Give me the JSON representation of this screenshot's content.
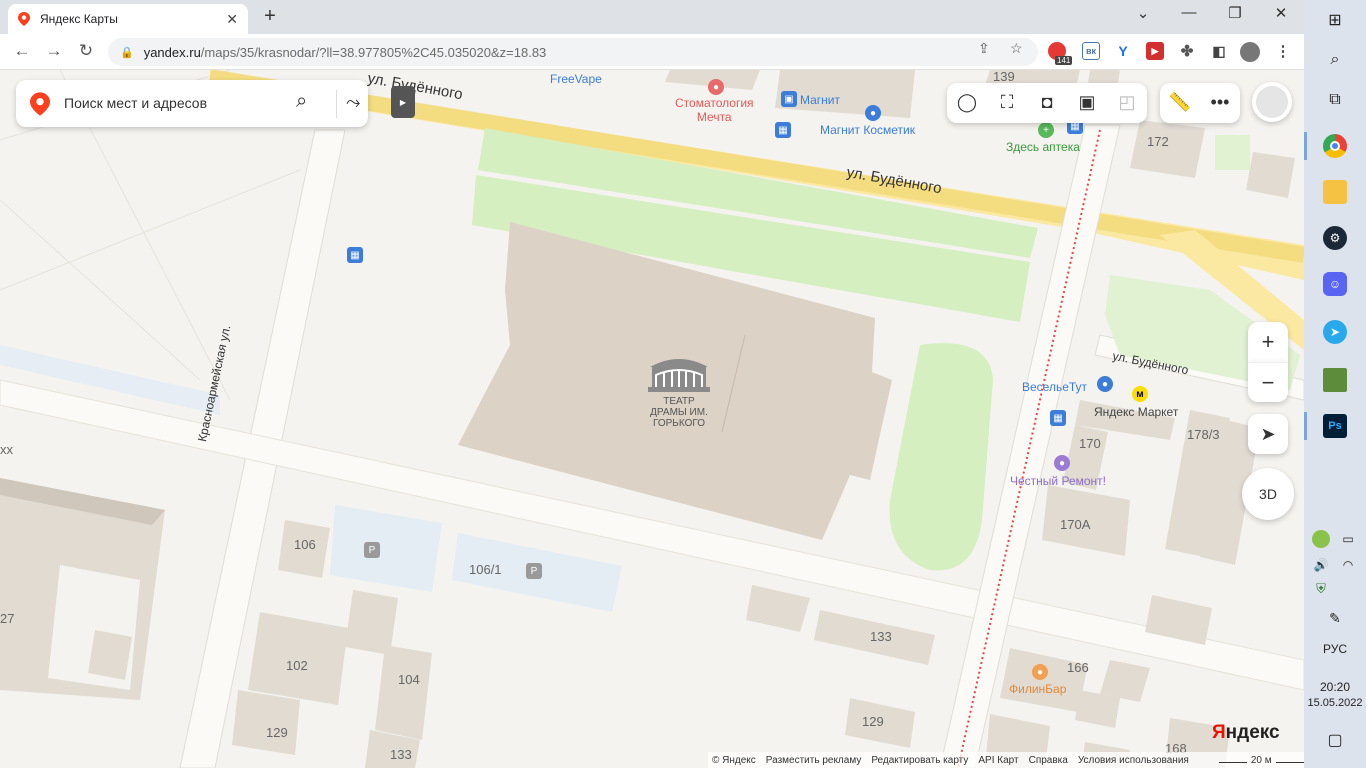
{
  "browser": {
    "tab_title": "Яндекс Карты",
    "url_host": "yandex.ru",
    "url_path": "/maps/35/krasnodar/?ll=38.977805%2C45.035020&z=18.83",
    "ext_badge": "141"
  },
  "search": {
    "placeholder": "Поиск мест и адресов"
  },
  "map": {
    "streets": {
      "budennogo_top": "ул. Будённого",
      "budennogo_mid": "ул. Будённого",
      "budennogo_right": "ул. Будённого",
      "krasnoarmeyskaya": "Красноармейская ул."
    },
    "pois": {
      "freevape": "FreeVape",
      "stomatology": "Стоматология\nМечта",
      "magnit": "Магнит",
      "magnit_cosmetic": "Магнит Косметик",
      "apteka": "Здесь аптека",
      "theatre": "ТЕАТР\nДРАМЫ ИМ.\nГОРЬКОГО",
      "veselye": "ВесельеТут",
      "yandex_market": "Яндекс Маркет",
      "chestny": "Честный Ремонт!",
      "filinbar": "ФилинБар",
      "parking": "P"
    },
    "houses": {
      "h139": "139",
      "h172": "172",
      "h170": "170",
      "h1783": "178/3",
      "h170a": "170А",
      "h106": "106",
      "h1061": "106/1",
      "h133a": "133",
      "h166": "166",
      "h102": "102",
      "h104": "104",
      "h129a": "129",
      "h133b": "133",
      "h129b": "129",
      "h27": "27",
      "h168": "168",
      "hxx": "хх"
    }
  },
  "controls": {
    "zoom_in": "+",
    "zoom_out": "−",
    "btn_3d": "3D"
  },
  "brand": {
    "logo_main": "Я",
    "logo_rest": "ндекс"
  },
  "footer": {
    "copyright": "© Яндекс",
    "ads": "Разместить рекламу",
    "edit": "Редактировать карту",
    "api": "API Карт",
    "help": "Справка",
    "terms": "Условия использования",
    "scale": "20 м"
  },
  "taskbar": {
    "lang": "РУС",
    "time": "20:20",
    "date": "15.05.2022"
  },
  "colors": {
    "road_yellow": "#fbe9a1",
    "park_green": "#d5efc0",
    "building": "#e1dbd2",
    "theatre": "#dcd2c6",
    "parking": "#e4ecf4",
    "accent_red": "#fc3f1d"
  }
}
